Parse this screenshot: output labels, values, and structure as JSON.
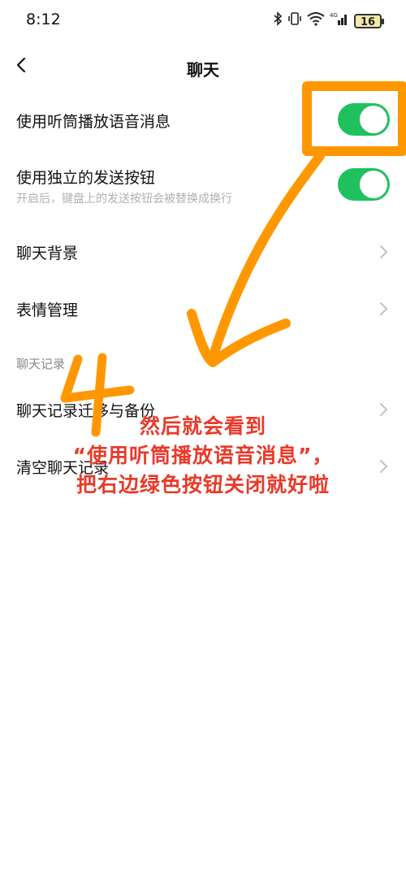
{
  "status_bar": {
    "time": "8:12",
    "battery": "16",
    "icons": [
      "bluetooth-icon",
      "vibrate-icon",
      "wifi-icon",
      "4g-signal-icon",
      "battery-icon"
    ]
  },
  "nav": {
    "title": "聊天",
    "back_icon": "chevron-left-icon"
  },
  "settings": {
    "earpiece_voice": {
      "label": "使用听筒播放语音消息",
      "enabled": true
    },
    "separate_send": {
      "label": "使用独立的发送按钮",
      "sublabel": "开启后，键盘上的发送按钮会被替换成换行",
      "enabled": true
    },
    "chat_background": {
      "label": "聊天背景"
    },
    "sticker_management": {
      "label": "表情管理"
    },
    "section_chat_history": "聊天记录",
    "chat_history_migration": {
      "label": "聊天记录迁移与备份"
    },
    "clear_chat_history": {
      "label": "清空聊天记录"
    }
  },
  "annotation": {
    "step_number": "4",
    "line1": "然后就会看到",
    "line2": "“使用听筒播放语音消息”，",
    "line3": "把右边绿色按钮关闭就好啦",
    "color_orange": "#ff9800",
    "color_red": "#e83a2a"
  },
  "colors": {
    "toggle_on": "#1fc15e",
    "subtext": "#b0b0b0",
    "section_header": "#8a8a8a"
  }
}
